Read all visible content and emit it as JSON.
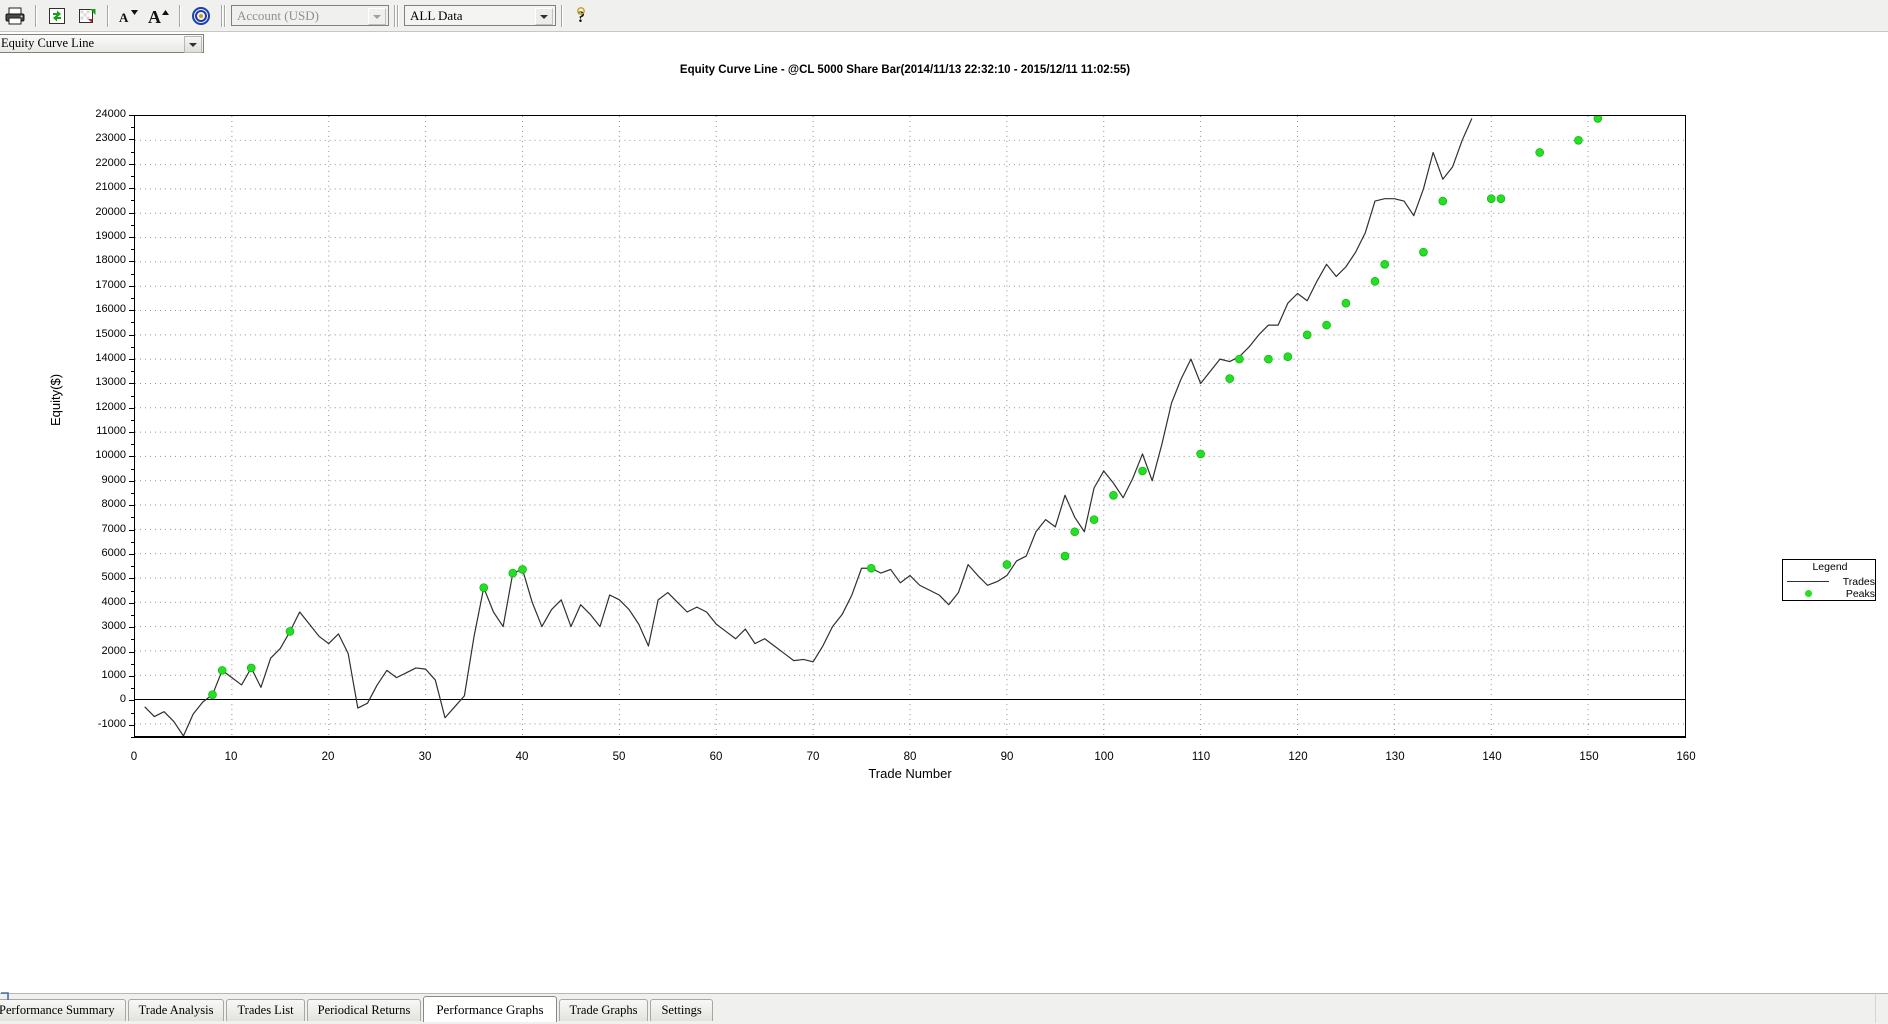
{
  "toolbar": {
    "buttons": [
      {
        "name": "print-button",
        "icon": "printer-icon",
        "title": "Print"
      },
      {
        "name": "refresh-button",
        "icon": "refresh-icon",
        "title": "Refresh"
      },
      {
        "name": "export-button",
        "icon": "export-icon",
        "title": "Export"
      },
      {
        "name": "decrease-font-button",
        "icon": "font-small-icon",
        "title": "Decrease Font"
      },
      {
        "name": "increase-font-button",
        "icon": "font-large-icon",
        "title": "Increase Font"
      },
      {
        "name": "target-button",
        "icon": "target-icon",
        "title": "Target"
      }
    ],
    "account_combo": {
      "value": "Account (USD)",
      "placeholder": "Account (USD)",
      "enabled": false
    },
    "data_combo": {
      "value": "ALL Data",
      "options": [
        "ALL Data"
      ]
    },
    "help_label": "?"
  },
  "chart_type_combo": {
    "value": "Equity Curve Line",
    "options": [
      "Equity Curve Line"
    ]
  },
  "legend": {
    "title": "Legend",
    "entries": [
      {
        "label": "Trades",
        "marker": "line",
        "color": "#303030"
      },
      {
        "label": "Peaks",
        "marker": "dot",
        "color": "#23e023"
      }
    ]
  },
  "tabs": [
    {
      "label": "Performance Summary",
      "active": false
    },
    {
      "label": "Trade Analysis",
      "active": false
    },
    {
      "label": "Trades List",
      "active": false
    },
    {
      "label": "Periodical Returns",
      "active": false
    },
    {
      "label": "Performance Graphs",
      "active": true
    },
    {
      "label": "Trade Graphs",
      "active": false
    },
    {
      "label": "Settings",
      "active": false
    }
  ],
  "chart_data": {
    "type": "line",
    "title": "Equity Curve Line - @CL 5000 Share Bar(2014/11/13 22:32:10 - 2015/12/11 11:02:55)",
    "xlabel": "Trade Number",
    "ylabel": "Equity($)",
    "xlim": [
      0,
      160
    ],
    "ylim": [
      -1500,
      24000
    ],
    "xticks": [
      0,
      10,
      20,
      30,
      40,
      50,
      60,
      70,
      80,
      90,
      100,
      110,
      120,
      130,
      140,
      150,
      160
    ],
    "yticks": [
      -1000,
      0,
      1000,
      2000,
      3000,
      4000,
      5000,
      6000,
      7000,
      8000,
      9000,
      10000,
      11000,
      12000,
      13000,
      14000,
      15000,
      16000,
      17000,
      18000,
      19000,
      20000,
      21000,
      22000,
      23000,
      24000
    ],
    "grid": true,
    "legend_position": "right",
    "line_color": "#303030",
    "peak_color": "#23e023",
    "series": [
      {
        "name": "Trades",
        "x": [
          1,
          2,
          3,
          4,
          5,
          6,
          7,
          8,
          9,
          10,
          11,
          12,
          13,
          14,
          15,
          16,
          17,
          18,
          19,
          20,
          21,
          22,
          23,
          24,
          25,
          26,
          27,
          28,
          29,
          30,
          31,
          32,
          33,
          34,
          35,
          36,
          37,
          38,
          39,
          40,
          41,
          42,
          43,
          44,
          45,
          46,
          47,
          48,
          49,
          50,
          51,
          52,
          53,
          54,
          55,
          56,
          57,
          58,
          59,
          60,
          61,
          62,
          63,
          64,
          65,
          66,
          67,
          68,
          69,
          70,
          71,
          72,
          73,
          74,
          75,
          76,
          77,
          78,
          79,
          80,
          81,
          82,
          83,
          84,
          85,
          86,
          87,
          88,
          89,
          90,
          91,
          92,
          93,
          94,
          95,
          96,
          97,
          98,
          99,
          100,
          101,
          102,
          103,
          104,
          105,
          106,
          107,
          108,
          109,
          110,
          111,
          112,
          113,
          114,
          115,
          116,
          117,
          118,
          119,
          120,
          121,
          122,
          123,
          124,
          125,
          126,
          127,
          128,
          129,
          130,
          131,
          132,
          133,
          134,
          135,
          136,
          137,
          138,
          139,
          140,
          141,
          142,
          143,
          144,
          145,
          146,
          147,
          148,
          149,
          150,
          151
        ],
        "values": [
          -300,
          -700,
          -500,
          -900,
          -1500,
          -600,
          -100,
          200,
          1200,
          900,
          600,
          1300,
          500,
          1700,
          2100,
          2800,
          3600,
          3100,
          2600,
          2300,
          2700,
          1900,
          -350,
          -150,
          600,
          1200,
          900,
          1100,
          1300,
          1250,
          800,
          -750,
          -300,
          150,
          2600,
          4600,
          3600,
          3000,
          5200,
          5350,
          4000,
          3000,
          3700,
          4100,
          3000,
          3900,
          3500,
          3000,
          4300,
          4100,
          3700,
          3100,
          2200,
          4100,
          4400,
          4000,
          3600,
          3800,
          3600,
          3100,
          2800,
          2500,
          2900,
          2300,
          2500,
          2200,
          1900,
          1600,
          1650,
          1550,
          2200,
          3000,
          3500,
          4300,
          5400,
          5400,
          5200,
          5350,
          4800,
          5100,
          4700,
          4500,
          4300,
          3900,
          4400,
          5550,
          5100,
          4700,
          4850,
          5100,
          5700,
          5900,
          6900,
          7400,
          7100,
          8400,
          7500,
          6900,
          8700,
          9400,
          8900,
          8300,
          9100,
          10100,
          9000,
          10500,
          12200,
          13200,
          14000,
          13000,
          13500,
          14000,
          13900,
          14100,
          14500,
          15000,
          15400,
          15400,
          16300,
          16700,
          16400,
          17200,
          17900,
          17400,
          17800,
          18400,
          19200,
          20500,
          20600,
          20600,
          20500,
          19900,
          21000,
          22500,
          21400,
          21900,
          23000,
          23900
        ],
        "peaks": [
          {
            "x": 8,
            "y": 200
          },
          {
            "x": 9,
            "y": 1200
          },
          {
            "x": 12,
            "y": 1300
          },
          {
            "x": 16,
            "y": 2800
          },
          {
            "x": 36,
            "y": 4600
          },
          {
            "x": 39,
            "y": 5200
          },
          {
            "x": 40,
            "y": 5350
          },
          {
            "x": 76,
            "y": 5400
          },
          {
            "x": 90,
            "y": 5550
          },
          {
            "x": 96,
            "y": 5900
          },
          {
            "x": 97,
            "y": 6900
          },
          {
            "x": 99,
            "y": 7400
          },
          {
            "x": 101,
            "y": 8400
          },
          {
            "x": 104,
            "y": 9400
          },
          {
            "x": 110,
            "y": 10100
          },
          {
            "x": 113,
            "y": 13200
          },
          {
            "x": 114,
            "y": 14000
          },
          {
            "x": 117,
            "y": 14000
          },
          {
            "x": 119,
            "y": 14100
          },
          {
            "x": 121,
            "y": 15000
          },
          {
            "x": 123,
            "y": 15400
          },
          {
            "x": 125,
            "y": 16300
          },
          {
            "x": 128,
            "y": 17200
          },
          {
            "x": 129,
            "y": 17900
          },
          {
            "x": 133,
            "y": 18400
          },
          {
            "x": 135,
            "y": 20500
          },
          {
            "x": 140,
            "y": 20600
          },
          {
            "x": 141,
            "y": 20600
          },
          {
            "x": 145,
            "y": 22500
          },
          {
            "x": 149,
            "y": 23000
          },
          {
            "x": 151,
            "y": 23900
          }
        ]
      }
    ]
  }
}
